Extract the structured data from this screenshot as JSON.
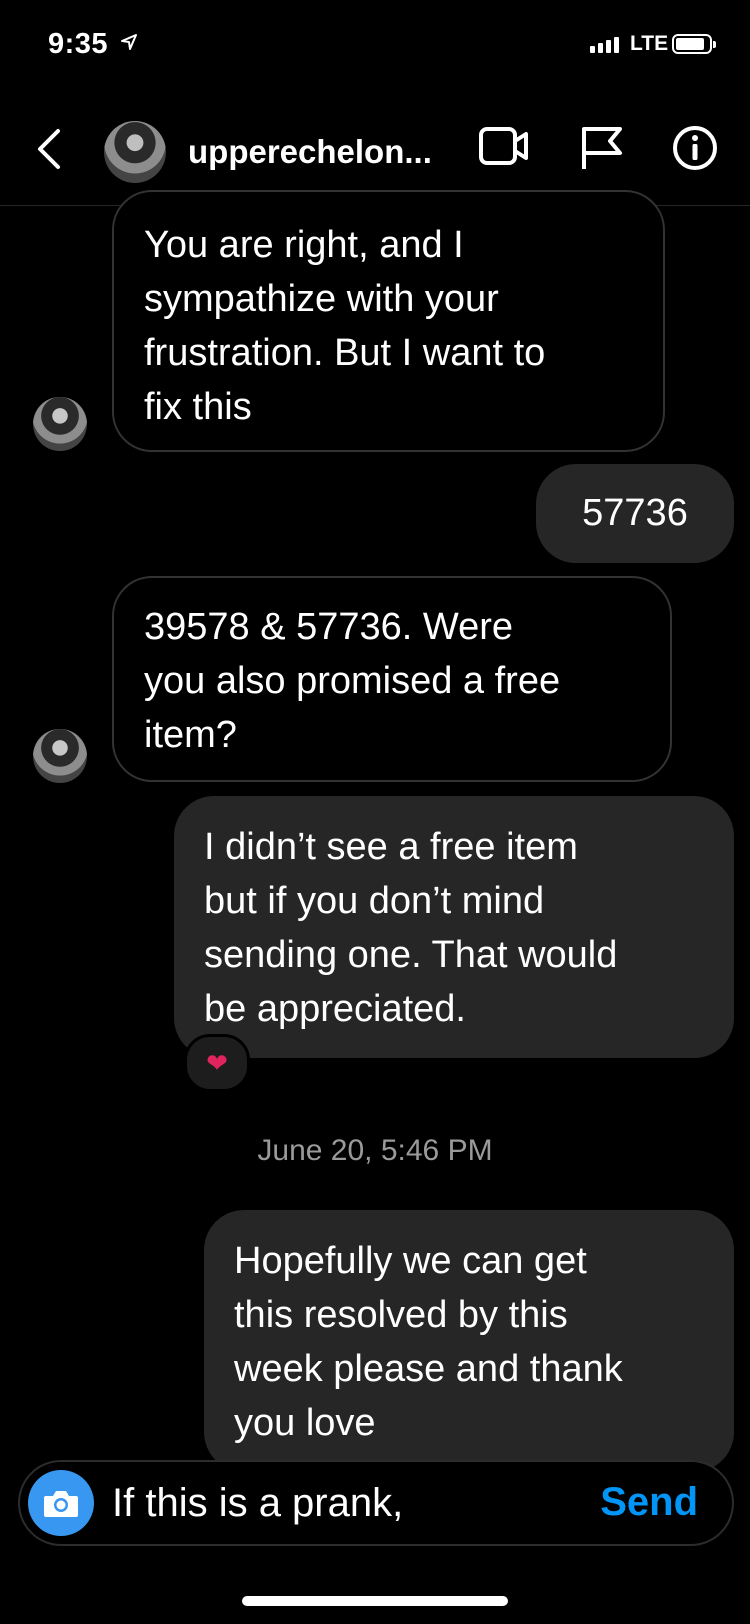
{
  "status": {
    "time": "9:35",
    "network": "LTE"
  },
  "header": {
    "username": "upperechelon..."
  },
  "messages": [
    {
      "direction": "in",
      "text": "You are right, and I\nsympathize with your\nfrustration. But I want to\nfix this"
    },
    {
      "direction": "out",
      "text": "57736"
    },
    {
      "direction": "in",
      "text": "39578 & 57736. Were\nyou also promised a free\nitem?"
    },
    {
      "direction": "out",
      "text": "I didn’t see a free item\nbut if you don’t mind\nsending one. That would\nbe appreciated.",
      "reaction": "❤"
    },
    {
      "direction": "out",
      "text": "Hopefully we can get\nthis resolved by this\nweek please and thank\nyou love"
    }
  ],
  "timestamp": "June 20, 5:46 PM",
  "composer": {
    "value": "If this is a prank,",
    "send_label": "Send"
  },
  "colors": {
    "accent": "#0095f6",
    "camera": "#3897f0",
    "outgoing_bubble": "#262626"
  }
}
